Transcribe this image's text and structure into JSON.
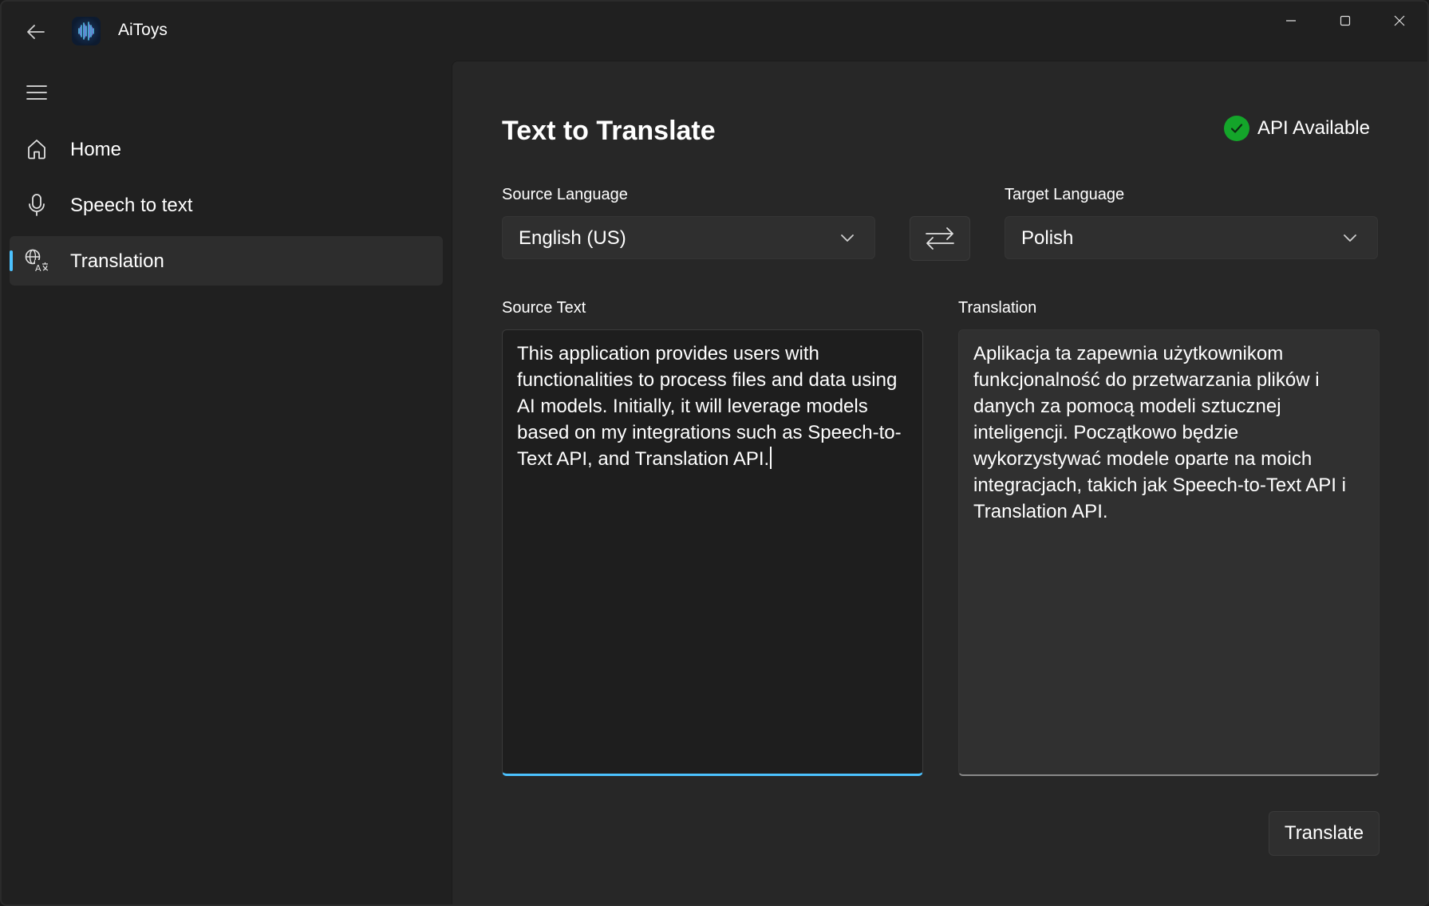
{
  "app": {
    "title": "AiToys"
  },
  "window_controls": {
    "minimize": "minimize-icon",
    "maximize": "maximize-icon",
    "close": "close-icon"
  },
  "nav": {
    "items": [
      {
        "label": "Home",
        "icon": "home-icon",
        "active": false
      },
      {
        "label": "Speech to text",
        "icon": "microphone-icon",
        "active": false
      },
      {
        "label": "Translation",
        "icon": "translate-icon",
        "active": true
      }
    ]
  },
  "page": {
    "title": "Text to Translate",
    "api_status": "API Available",
    "source_language_label": "Source Language",
    "source_language_value": "English (US)",
    "target_language_label": "Target Language",
    "target_language_value": "Polish",
    "source_text_label": "Source Text",
    "source_text": "This application provides users with functionalities to process files and data using AI models. Initially, it will leverage models based on my integrations such as Speech-to-Text API, and Translation API.",
    "translation_label": "Translation",
    "translation_text": "Aplikacja ta zapewnia użytkownikom funkcjonalność do przetwarzania plików i danych za pomocą modeli sztucznej inteligencji. Początkowo będzie wykorzystywać modele oparte na moich integracjach, takich jak Speech-to-Text API i Translation API.",
    "translate_button": "Translate"
  },
  "colors": {
    "accent": "#4cc2ff",
    "status_ok": "#14a52a",
    "window_bg": "#202020",
    "content_bg": "#272727"
  }
}
